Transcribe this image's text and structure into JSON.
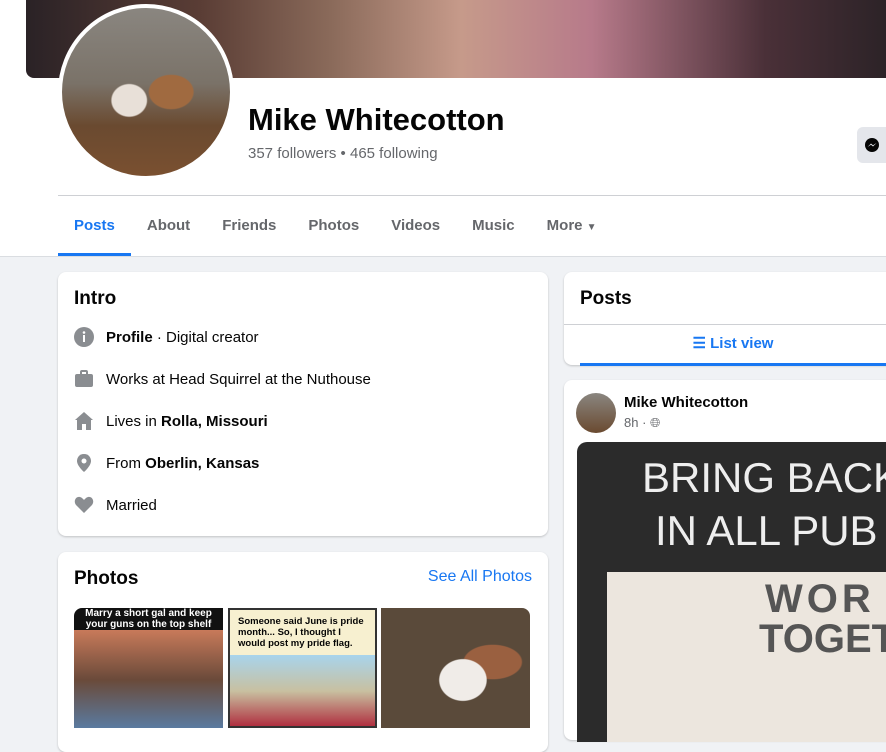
{
  "profile": {
    "name": "Mike Whitecotton",
    "followers": "357 followers",
    "sep": " • ",
    "following": "465 following"
  },
  "tabs": [
    "Posts",
    "About",
    "Friends",
    "Photos",
    "Videos",
    "Music",
    "More"
  ],
  "intro": {
    "title": "Intro",
    "items": [
      {
        "icon": "info-icon",
        "pre": "",
        "bold": "Profile",
        "post": " · Digital creator"
      },
      {
        "icon": "briefcase-icon",
        "pre": "Works at Head Squirrel at the Nuthouse",
        "bold": "",
        "post": ""
      },
      {
        "icon": "home-icon",
        "pre": "Lives in ",
        "bold": "Rolla, Missouri",
        "post": ""
      },
      {
        "icon": "location-pin-icon",
        "pre": "From ",
        "bold": "Oberlin, Kansas",
        "post": ""
      },
      {
        "icon": "heart-icon",
        "pre": "Married",
        "bold": "",
        "post": ""
      }
    ]
  },
  "photos": {
    "title": "Photos",
    "see_all": "See All Photos",
    "captions": [
      "Marry a short gal and keep your guns on the top shelf",
      "Someone said June is pride month... So, I thought I would post my pride flag.",
      ""
    ]
  },
  "posts": {
    "title": "Posts",
    "list_view": "List view"
  },
  "post": {
    "author": "Mike Whitecotton",
    "time": "8h",
    "dot": " · ",
    "image_text_1": "BRING BACK",
    "image_text_2": "IN ALL PUB",
    "sign_1": "WOR",
    "sign_2": "TOGETHE"
  },
  "colors": {
    "accent": "#1877f2",
    "background": "#f0f2f5",
    "icon_gray": "#8a8d91"
  }
}
